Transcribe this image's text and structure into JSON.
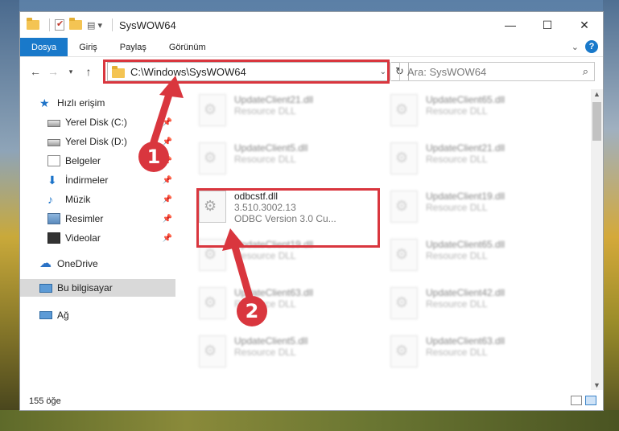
{
  "window": {
    "title": "SysWOW64",
    "controls": {
      "minimize": "—",
      "maximize": "☐",
      "close": "✕"
    }
  },
  "ribbon": {
    "tabs": [
      "Dosya",
      "Giriş",
      "Paylaş",
      "Görünüm"
    ],
    "help": "?"
  },
  "nav": {
    "address": "C:\\Windows\\SysWOW64",
    "search_placeholder": "Ara: SysWOW64"
  },
  "sidebar": {
    "items": [
      {
        "label": "Hızlı erişim",
        "icon": "star-icon"
      },
      {
        "label": "Yerel Disk (C:)",
        "icon": "disk-icon",
        "pinned": true
      },
      {
        "label": "Yerel Disk (D:)",
        "icon": "disk-icon",
        "pinned": true
      },
      {
        "label": "Belgeler",
        "icon": "document-icon",
        "pinned": true
      },
      {
        "label": "İndirmeler",
        "icon": "download-icon",
        "pinned": true
      },
      {
        "label": "Müzik",
        "icon": "music-icon",
        "pinned": true
      },
      {
        "label": "Resimler",
        "icon": "pictures-icon",
        "pinned": true
      },
      {
        "label": "Videolar",
        "icon": "video-icon",
        "pinned": true
      },
      {
        "label": "OneDrive",
        "icon": "cloud-icon"
      },
      {
        "label": "Bu bilgisayar",
        "icon": "computer-icon",
        "selected": true
      },
      {
        "label": "Ağ",
        "icon": "network-icon"
      }
    ]
  },
  "files": {
    "left_column": [
      {
        "name": "UpdateClient21.dll",
        "sub": "Resource DLL"
      },
      {
        "name": "UpdateClient5.dll",
        "sub": "Resource DLL"
      },
      {
        "name": "odbcstf.dll",
        "sub": "3.510.3002.13",
        "sub2": "ODBC Version 3.0 Cu..."
      },
      {
        "name": "UpdateClient19.dll",
        "sub": "Resource DLL"
      },
      {
        "name": "UpdateClient63.dll",
        "sub": "Resource DLL"
      },
      {
        "name": "UpdateClient5.dll",
        "sub": "Resource DLL"
      }
    ],
    "right_column": [
      {
        "name": "UpdateClient65.dll",
        "sub": "Resource DLL"
      },
      {
        "name": "UpdateClient21.dll",
        "sub": "Resource DLL"
      },
      {
        "name": "UpdateClient19.dll",
        "sub": "Resource DLL"
      },
      {
        "name": "UpdateClient65.dll",
        "sub": "Resource DLL"
      },
      {
        "name": "UpdateClient42.dll",
        "sub": "Resource DLL"
      },
      {
        "name": "UpdateClient63.dll",
        "sub": "Resource DLL"
      }
    ]
  },
  "status": {
    "count": "155 öğe"
  },
  "callouts": {
    "first": "1",
    "second": "2",
    "color": "#d9363e"
  }
}
